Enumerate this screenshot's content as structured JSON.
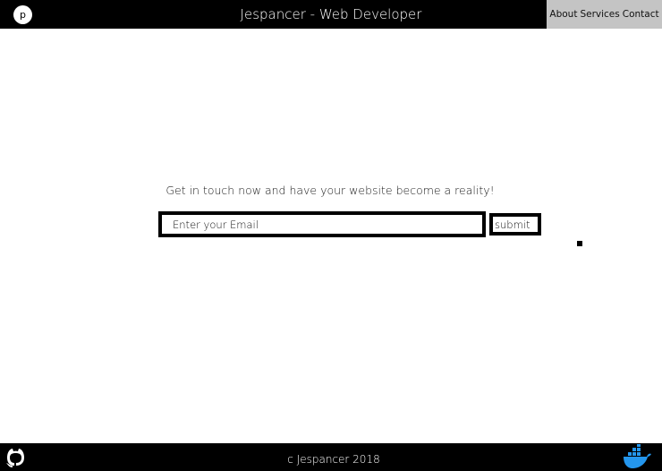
{
  "header": {
    "logo_letter": "p",
    "title": "Jespancer - Web Developer",
    "nav": [
      "About",
      "Services",
      "Contact"
    ]
  },
  "main": {
    "cta_text": "Get in touch now and have your website become a reality!",
    "email_placeholder": "Enter your Email",
    "submit_label": "submit"
  },
  "footer": {
    "copyright": "c Jespancer 2018",
    "icons": [
      "github-icon",
      "docker-icon"
    ]
  },
  "colors": {
    "header_bg": "#000000",
    "nav_bg": "#c4c4c4",
    "footer_bg": "#000000",
    "docker_blue": "#2496ed"
  }
}
